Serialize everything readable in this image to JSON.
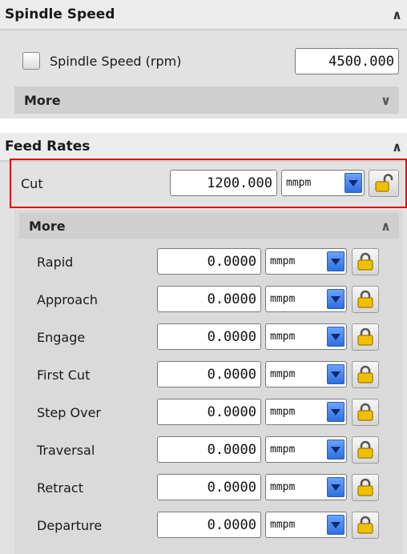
{
  "spindle": {
    "title": "Spindle Speed",
    "checkbox_label": "Spindle Speed (rpm)",
    "value": "4500.000",
    "more_label": "More"
  },
  "feed": {
    "title": "Feed Rates",
    "cut_label": "Cut",
    "cut_value": "1200.000",
    "cut_unit": "mmpm",
    "more_label": "More",
    "rows": [
      {
        "label": "Rapid",
        "value": "0.0000",
        "unit": "mmpm"
      },
      {
        "label": "Approach",
        "value": "0.0000",
        "unit": "mmpm"
      },
      {
        "label": "Engage",
        "value": "0.0000",
        "unit": "mmpm"
      },
      {
        "label": "First Cut",
        "value": "0.0000",
        "unit": "mmpm"
      },
      {
        "label": "Step Over",
        "value": "0.0000",
        "unit": "mmpm"
      },
      {
        "label": "Traversal",
        "value": "0.0000",
        "unit": "mmpm"
      },
      {
        "label": "Retract",
        "value": "0.0000",
        "unit": "mmpm"
      },
      {
        "label": "Departure",
        "value": "0.0000",
        "unit": "mmpm"
      }
    ]
  },
  "icons": {
    "collapse": "chevron-up-icon",
    "expand": "chevron-down-icon",
    "lock": "padlock-icon",
    "dropdown": "dropdown-arrow-icon"
  },
  "colors": {
    "highlight_border": "#e01010",
    "dropdown_blue": "#2e6fe0",
    "lock_gold": "#e8b800"
  }
}
